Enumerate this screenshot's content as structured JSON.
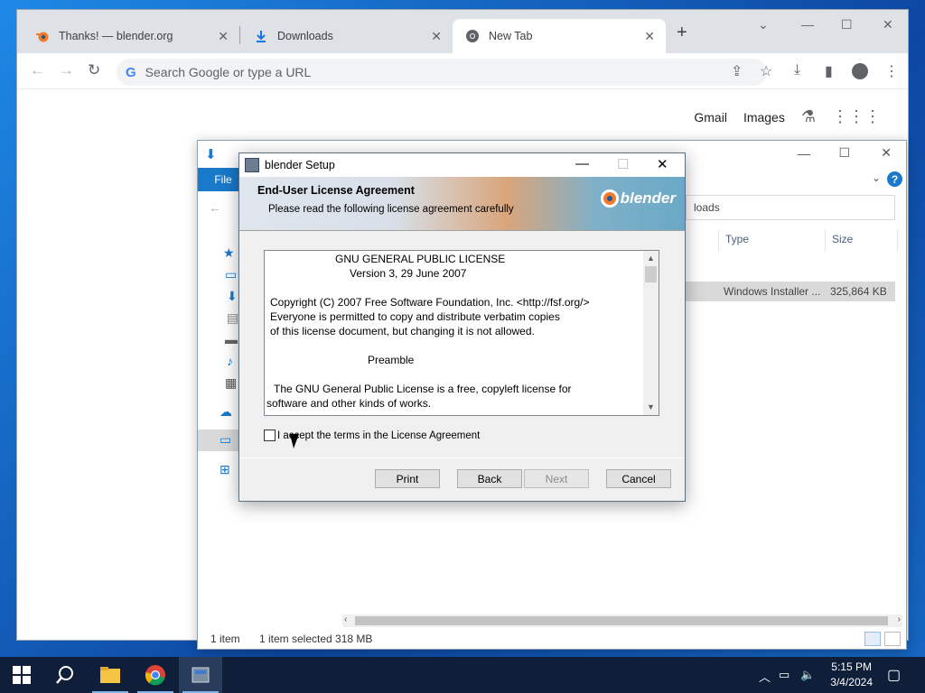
{
  "browser": {
    "tabs": [
      {
        "title": "Thanks! — blender.org",
        "icon": "blender-icon"
      },
      {
        "title": "Downloads",
        "icon": "download-icon"
      },
      {
        "title": "New Tab",
        "icon": "chrome-icon"
      }
    ],
    "omnibox_placeholder": "Search Google or type a URL",
    "ntp_links": {
      "gmail": "Gmail",
      "images": "Images"
    }
  },
  "explorer": {
    "file_tab": "File",
    "address_tail": "loads",
    "columns": {
      "type": "Type",
      "size": "Size"
    },
    "selected_file": {
      "type": "Windows Installer ...",
      "size": "325,864 KB"
    },
    "status": {
      "count": "1 item",
      "selected": "1 item selected  318 MB"
    }
  },
  "setup": {
    "title": "blender Setup",
    "banner_heading": "End-User License Agreement",
    "banner_sub": "Please read the following license agreement carefully",
    "logo_text": "blender",
    "license_lines": [
      "GNU GENERAL PUBLIC LICENSE",
      "Version 3, 29 June 2007",
      "Copyright (C) 2007 Free Software Foundation, Inc. <http://fsf.org/>",
      "Everyone is permitted to copy and distribute verbatim copies",
      "of this license document, but changing it is not allowed.",
      "Preamble",
      "The GNU General Public License is a free, copyleft license for",
      "software and other kinds of works."
    ],
    "accept_label": "I accept the terms in the License Agreement",
    "accept_checked": false,
    "buttons": {
      "print": "Print",
      "back": "Back",
      "next": "Next",
      "cancel": "Cancel"
    }
  },
  "taskbar": {
    "time": "5:15 PM",
    "date": "3/4/2024"
  }
}
